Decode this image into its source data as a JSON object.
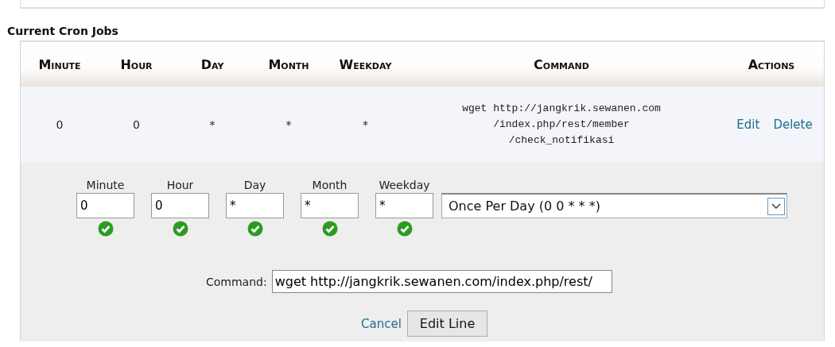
{
  "section_title": "Current Cron Jobs",
  "table": {
    "columns": [
      "Minute",
      "Hour",
      "Day",
      "Month",
      "Weekday",
      "Command",
      "Actions"
    ],
    "rows": [
      {
        "cells": [
          "0",
          "0",
          "*",
          "*",
          "*"
        ],
        "command": [
          "wget http://jangkrik.sewanen.com",
          "/index.php/rest/member",
          "/check_notifikasi"
        ],
        "actions": [
          "Edit",
          "Delete"
        ]
      }
    ]
  },
  "editor": {
    "fields": [
      {
        "label": "Minute",
        "value": "0",
        "valid": true
      },
      {
        "label": "Hour",
        "value": "0",
        "valid": true
      },
      {
        "label": "Day",
        "value": "*",
        "valid": true
      },
      {
        "label": "Month",
        "value": "*",
        "valid": true
      },
      {
        "label": "Weekday",
        "value": "*",
        "valid": true
      }
    ],
    "preset": {
      "value": "Once Per Day (0 0 * * *)"
    },
    "command": {
      "label": "Command:",
      "value": "wget http://jangkrik.sewanen.com/index.php/rest/"
    },
    "cancel": "Cancel",
    "submit": "Edit Line"
  }
}
